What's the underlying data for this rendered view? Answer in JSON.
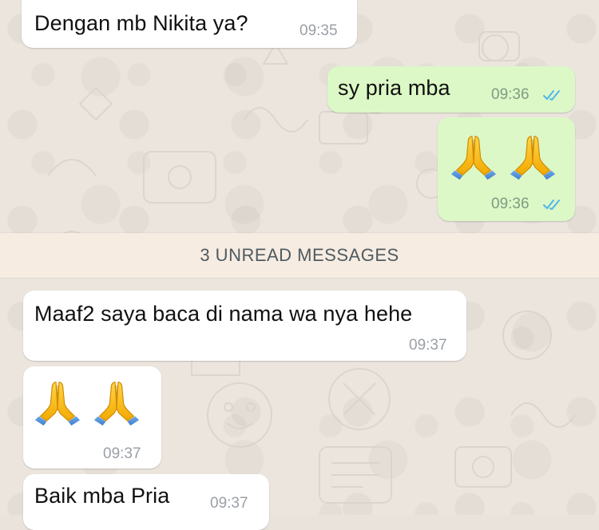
{
  "messages": [
    {
      "direction": "incoming",
      "text": "Dengan mb Nikita ya?",
      "time": "09:35"
    },
    {
      "direction": "outgoing",
      "text": "sy pria mba",
      "time": "09:36",
      "status": "read"
    },
    {
      "direction": "outgoing",
      "emoji": [
        "folded-hands",
        "folded-hands"
      ],
      "time": "09:36",
      "status": "read"
    },
    {
      "direction": "incoming",
      "text": "Maaf2 saya baca di nama wa nya hehe",
      "time": "09:37"
    },
    {
      "direction": "incoming",
      "emoji": [
        "folded-hands",
        "folded-hands"
      ],
      "time": "09:37"
    },
    {
      "direction": "incoming",
      "text": "Baik mba Pria",
      "time": "09:37"
    }
  ],
  "unread_divider": {
    "label": "3 UNREAD MESSAGES"
  },
  "colors": {
    "incoming_bubble": "#ffffff",
    "outgoing_bubble": "#dcf8c6",
    "read_ticks": "#4fb6ec",
    "divider_background": "#f6ece2",
    "wallpaper": "#ebe5de"
  }
}
